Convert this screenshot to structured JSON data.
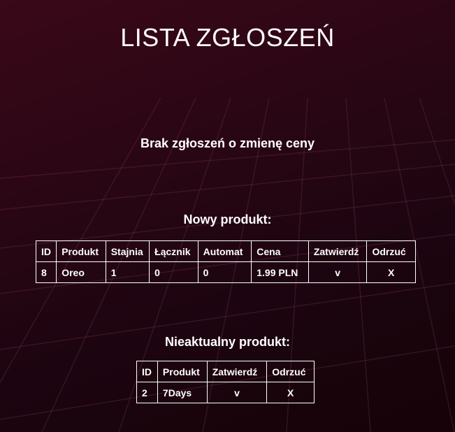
{
  "page": {
    "title": "LISTA ZGŁOSZEŃ",
    "no_price_change_message": "Brak zgłoszeń o zmienę ceny"
  },
  "new_product": {
    "heading": "Nowy produkt:",
    "columns": [
      "ID",
      "Produkt",
      "Stajnia",
      "Łącznik",
      "Automat",
      "Cena",
      "Zatwierdź",
      "Odrzuć"
    ],
    "rows": [
      {
        "id": "8",
        "product": "Oreo",
        "stajnia": "1",
        "lacznik": "0",
        "automat": "0",
        "price": "1.99 PLN",
        "approve": "v",
        "reject": "X"
      }
    ]
  },
  "outdated_product": {
    "heading": "Nieaktualny produkt:",
    "columns": [
      "ID",
      "Produkt",
      "Zatwierdź",
      "Odrzuć"
    ],
    "rows": [
      {
        "id": "2",
        "product": "7Days",
        "approve": "v",
        "reject": "X"
      }
    ]
  },
  "colors": {
    "background_top": "#3a0818",
    "background_bottom": "#160208",
    "grid_line": "#5a2a3c",
    "text": "#ffffff"
  }
}
